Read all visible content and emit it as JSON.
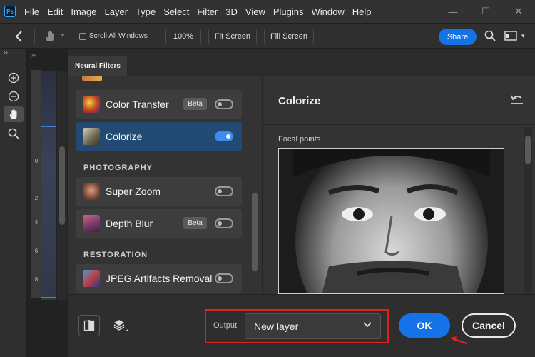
{
  "app": {
    "logo_text": "Ps"
  },
  "menu": [
    "File",
    "Edit",
    "Image",
    "Layer",
    "Type",
    "Select",
    "Filter",
    "3D",
    "View",
    "Plugins",
    "Window",
    "Help"
  ],
  "window_controls": {
    "minimize": "—",
    "maximize": "☐",
    "close": "✕"
  },
  "options_bar": {
    "scroll_all_windows": "Scroll All Windows",
    "zoom_100": "100%",
    "fit_screen": "Fit Screen",
    "fill_screen": "Fill Screen",
    "share": "Share"
  },
  "ruler": [
    "0",
    "2",
    "4",
    "6",
    "8"
  ],
  "dialog": {
    "tab_label": "Neural Filters",
    "filters": [
      {
        "label": "Color Transfer",
        "badge": "Beta",
        "enabled": false
      },
      {
        "label": "Colorize",
        "badge": "",
        "enabled": true
      }
    ],
    "sections": [
      {
        "heading": "PHOTOGRAPHY",
        "filters": [
          {
            "label": "Super Zoom",
            "badge": "",
            "enabled": false
          },
          {
            "label": "Depth Blur",
            "badge": "Beta",
            "enabled": false
          }
        ]
      },
      {
        "heading": "RESTORATION",
        "filters": [
          {
            "label": "JPEG Artifacts Removal",
            "badge": "",
            "enabled": false
          }
        ]
      }
    ],
    "settings": {
      "title": "Colorize",
      "focal_points_label": "Focal points"
    },
    "footer": {
      "output_label": "Output",
      "output_value": "New layer",
      "ok": "OK",
      "cancel": "Cancel"
    }
  },
  "colors": {
    "accent_blue": "#1473e6",
    "selected_item": "#224a73",
    "highlight_red": "#e0201c"
  }
}
